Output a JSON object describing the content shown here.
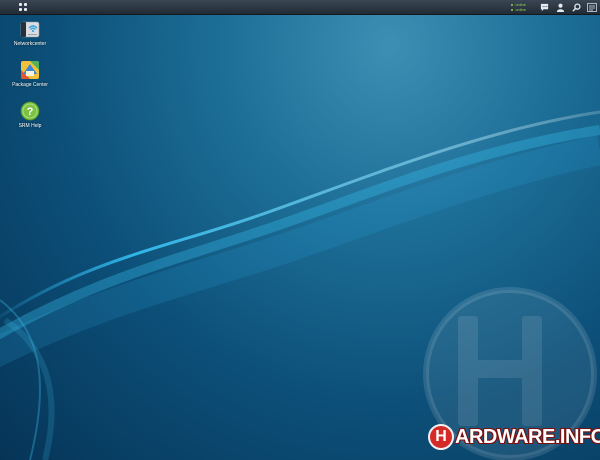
{
  "taskbar": {
    "main_menu_icon": "grid-icon",
    "status_lines": [
      "online",
      "online"
    ],
    "tray_icons": [
      "chat-icon",
      "user-icon",
      "search-icon",
      "widgets-icon"
    ]
  },
  "desktop": {
    "shortcuts": [
      {
        "label": "Networkcenter",
        "icon": "network-center-icon"
      },
      {
        "label": "Package Center",
        "icon": "package-center-icon"
      },
      {
        "label": "SRM Help",
        "icon": "help-icon"
      }
    ]
  },
  "watermark": {
    "letter": "H"
  },
  "brand": {
    "badge": "H",
    "text": "ARDWARE.INFO",
    "color": "#d42b28"
  },
  "colors": {
    "accent": "#3ec3f0",
    "status": "#8fcf4f"
  }
}
